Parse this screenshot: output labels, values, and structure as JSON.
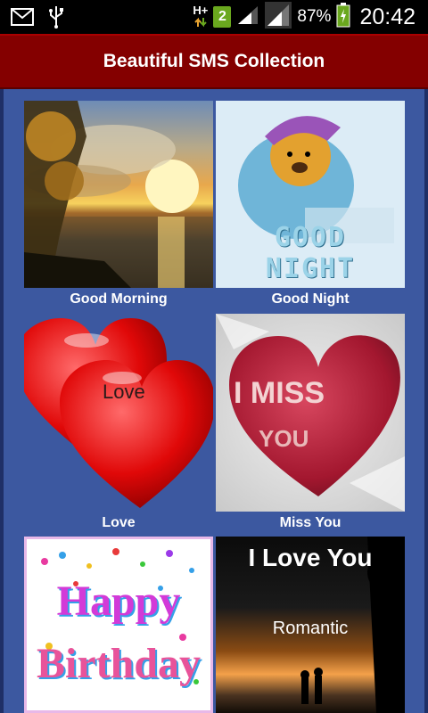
{
  "status_bar": {
    "network_type": "H+",
    "sim_slot": "2",
    "battery_percent": "87%",
    "time": "20:42",
    "icons": [
      "email-icon",
      "usb-icon",
      "data-arrows-icon",
      "sim-2-icon",
      "signal-icon",
      "signal-icon",
      "battery-charging-icon"
    ]
  },
  "title_bar": {
    "title": "Beautiful SMS Collection",
    "color": "#840000"
  },
  "content": {
    "background": "#3c58a0"
  },
  "categories": [
    {
      "label": "Good Morning",
      "image": "sunset-image"
    },
    {
      "label": "Good Night",
      "image": "good-night-bear-image",
      "image_text": "GOOD NIGHT"
    },
    {
      "label": "Love",
      "image": "hearts-image",
      "image_text": "Love"
    },
    {
      "label": "Miss You",
      "image": "miss-you-heart-image",
      "image_text_1": "I MISS",
      "image_text_2": "YOU"
    },
    {
      "label": "",
      "image": "happy-birthday-image",
      "image_text_1": "Happy",
      "image_text_2": "Birthday"
    },
    {
      "label": "",
      "image": "romantic-image",
      "image_text_1": "I Love You",
      "image_text_2": "Romantic"
    }
  ]
}
